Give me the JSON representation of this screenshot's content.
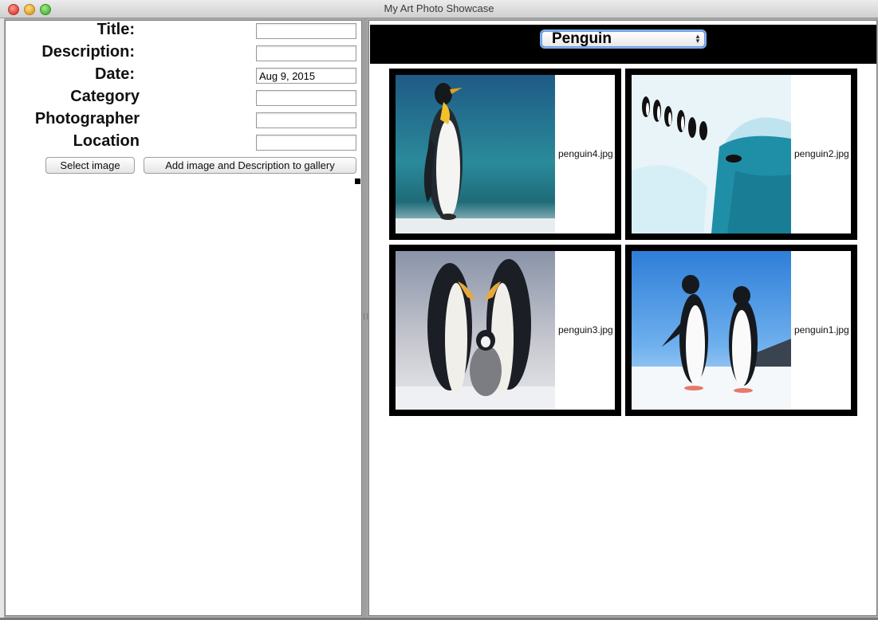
{
  "window": {
    "title": "My Art Photo Showcase"
  },
  "form": {
    "fields": [
      {
        "label": "Title:",
        "value": ""
      },
      {
        "label": "Description:",
        "value": ""
      },
      {
        "label": "Date:",
        "value": "Aug 9, 2015"
      },
      {
        "label": "Category",
        "value": ""
      },
      {
        "label": "Photographer",
        "value": ""
      },
      {
        "label": "Location",
        "value": ""
      }
    ],
    "select_image_label": "Select image",
    "add_to_gallery_label": "Add image and Description to gallery"
  },
  "gallery": {
    "category_selected": "Penguin",
    "items": [
      {
        "filename": "penguin4.jpg"
      },
      {
        "filename": "penguin2.jpg"
      },
      {
        "filename": "penguin3.jpg"
      },
      {
        "filename": "penguin1.jpg"
      }
    ]
  }
}
